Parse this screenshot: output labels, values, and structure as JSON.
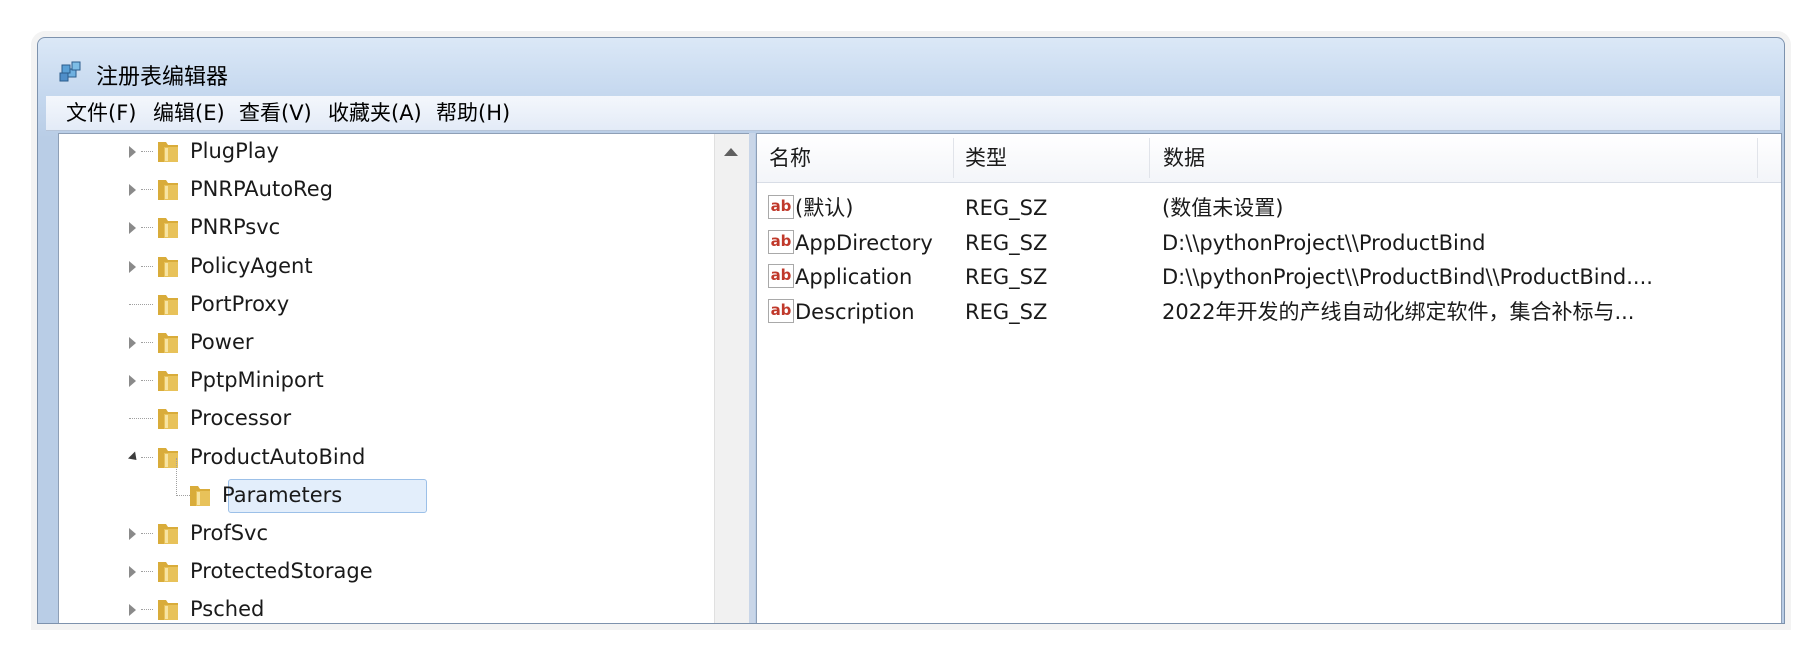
{
  "window": {
    "title": "注册表编辑器"
  },
  "menu": [
    "文件(F)",
    "编辑(E)",
    "查看(V)",
    "收藏夹(A)",
    "帮助(H)"
  ],
  "tree": {
    "items": [
      {
        "label": "PlugPlay",
        "expander": "closed"
      },
      {
        "label": "PNRPAutoReg",
        "expander": "closed"
      },
      {
        "label": "PNRPsvc",
        "expander": "closed"
      },
      {
        "label": "PolicyAgent",
        "expander": "closed"
      },
      {
        "label": "PortProxy",
        "expander": "none"
      },
      {
        "label": "Power",
        "expander": "closed"
      },
      {
        "label": "PptpMiniport",
        "expander": "closed"
      },
      {
        "label": "Processor",
        "expander": "none"
      },
      {
        "label": "ProductAutoBind",
        "expander": "open"
      },
      {
        "label": "Parameters",
        "expander": "none",
        "selected": true,
        "child": true
      },
      {
        "label": "ProfSvc",
        "expander": "closed"
      },
      {
        "label": "ProtectedStorage",
        "expander": "closed"
      },
      {
        "label": "Psched",
        "expander": "closed"
      }
    ]
  },
  "list": {
    "columns": [
      "名称",
      "类型",
      "数据"
    ],
    "rows": [
      {
        "icon": "ab-string-icon",
        "name": "(默认)",
        "type": "REG_SZ",
        "data": "(数值未设置)"
      },
      {
        "icon": "ab-string-icon",
        "name": "AppDirectory",
        "type": "REG_SZ",
        "data": "D:\\\\pythonProject\\\\ProductBind"
      },
      {
        "icon": "ab-string-icon",
        "name": "Application",
        "type": "REG_SZ",
        "data": "D:\\\\pythonProject\\\\ProductBind\\\\ProductBind...."
      },
      {
        "icon": "ab-string-icon",
        "name": "Description",
        "type": "REG_SZ",
        "data": "2022年开发的产线自动化绑定软件，集合补标与..."
      }
    ]
  },
  "icons": {
    "ab_label": "ab"
  },
  "colors": {
    "selection_bg": "#e3eefb",
    "selection_border": "#9cc0e8",
    "folder": "#e8c25a"
  }
}
